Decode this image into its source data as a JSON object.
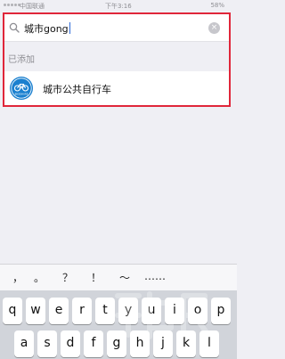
{
  "status_bar": {
    "carrier": "中国联通",
    "time": "下午3:16",
    "battery": "58%"
  },
  "search": {
    "query": "城市gong",
    "clear_icon": "clear-icon"
  },
  "section": {
    "header": "已添加"
  },
  "results": [
    {
      "label": "城市公共自行车",
      "icon": "bicycle-app-icon",
      "icon_caption": "BIKESHARE"
    }
  ],
  "candidates": [
    "，",
    "。",
    "？",
    "！",
    "～",
    "……"
  ],
  "keyboard": {
    "row1": [
      "q",
      "w",
      "e",
      "r",
      "t",
      "y",
      "u",
      "i",
      "o",
      "p"
    ],
    "row2": [
      "a",
      "s",
      "d",
      "f",
      "g",
      "h",
      "j",
      "k",
      "l"
    ]
  },
  "colors": {
    "highlight": "#e0263a",
    "app_icon": "#1b80cf",
    "cursor": "#2f6bd8"
  }
}
